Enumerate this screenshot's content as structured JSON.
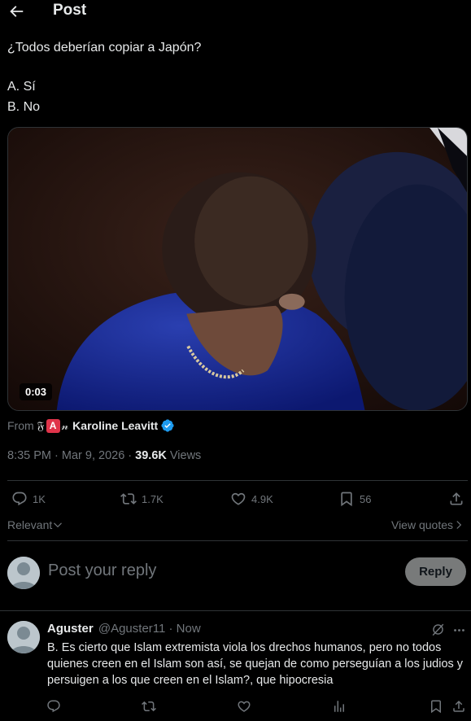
{
  "header": {
    "title": "Post"
  },
  "tweet": {
    "text_question": "¿Todos deberían copiar a Japón?",
    "option_a": "A. Sí",
    "option_b": "B. No",
    "video_duration": "0:03",
    "from_label": "From",
    "from_symbol_left": "𝔉",
    "from_badge": "A",
    "from_symbol_right": "𝓃",
    "from_name": "Karoline Leavitt",
    "timestamp": "8:35 PM · Mar 9, 2026 · ",
    "views_count": "39.6K",
    "views_label": " Views"
  },
  "actions": {
    "replies": "1K",
    "reposts": "1.7K",
    "likes": "4.9K",
    "bookmarks": "56"
  },
  "sort": {
    "label": "Relevant",
    "view_quotes": "View quotes"
  },
  "composer": {
    "placeholder": "Post your reply",
    "button": "Reply"
  },
  "reply": {
    "name": "Aguster",
    "handle": "@Aguster11 · Now",
    "text": "B. Es cierto que Islam extremista viola los drechos humanos, pero no todos quienes creen en el Islam son así, se quejan de como perseguían a los judios y persuigen a los que creen en el Islam?, que hipocresia"
  },
  "colors": {
    "background": "#000000",
    "text": "#e7e9ea",
    "muted": "#71767b",
    "border": "#2f3336",
    "verified": "#1d9bf0",
    "reply_button": "#787a7a"
  }
}
